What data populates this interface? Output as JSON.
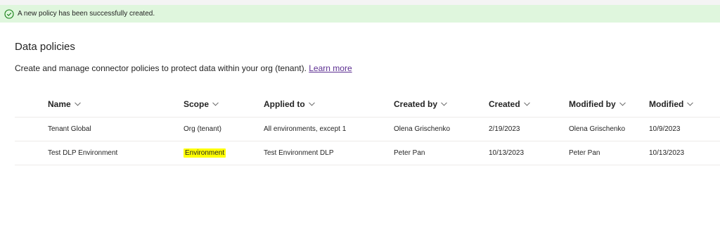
{
  "banner": {
    "message": "A new policy has been successfully created."
  },
  "page": {
    "title": "Data policies",
    "subtitle": "Create and manage connector policies to protect data within your org (tenant).",
    "learn_more": "Learn more"
  },
  "table": {
    "columns": [
      "Name",
      "Scope",
      "Applied to",
      "Created by",
      "Created",
      "Modified by",
      "Modified"
    ],
    "rows": [
      {
        "name": "Tenant Global",
        "scope": "Org (tenant)",
        "applied_to": "All environments, except 1",
        "created_by": "Olena Grischenko",
        "created": "2/19/2023",
        "modified_by": "Olena Grischenko",
        "modified": "10/9/2023"
      },
      {
        "name": "Test DLP Environment",
        "scope": "Environment",
        "applied_to": "Test Environment DLP",
        "created_by": "Peter Pan",
        "created": "10/13/2023",
        "modified_by": "Peter Pan",
        "modified": "10/13/2023"
      }
    ]
  },
  "colors": {
    "success_bg": "#dff6dd",
    "success_icon": "#107c10",
    "link": "#5c2e91",
    "highlight": "#ffff00"
  }
}
